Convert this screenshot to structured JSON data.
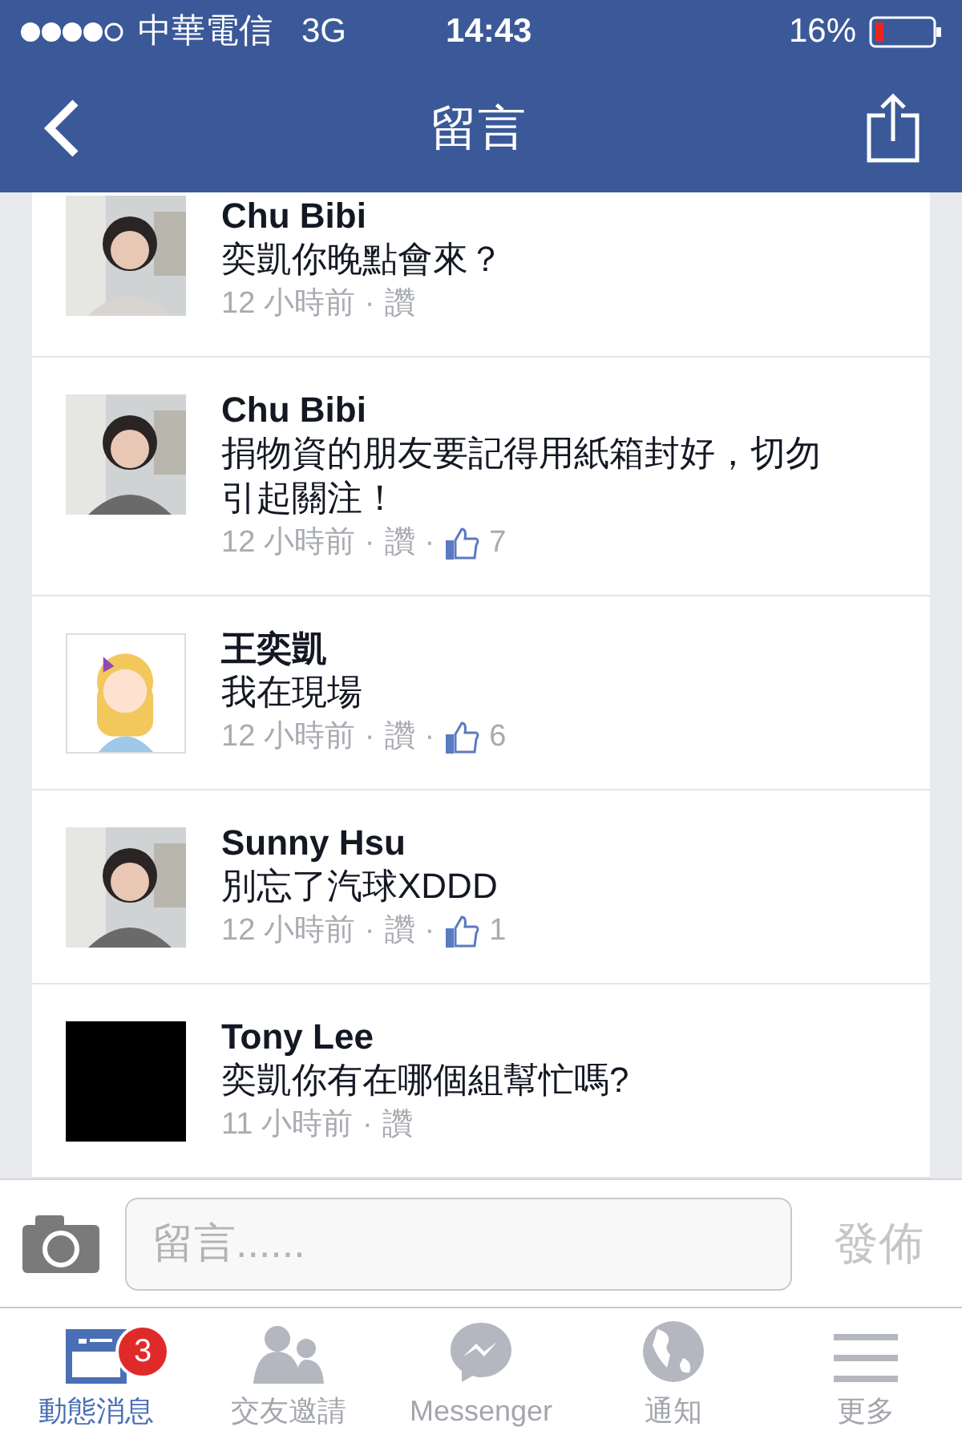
{
  "status_bar": {
    "carrier": "中華電信",
    "network": "3G",
    "time": "14:43",
    "battery": "16%"
  },
  "nav": {
    "title": "留言"
  },
  "comments": [
    {
      "name": "Chu Bibi",
      "message": "奕凱你晚點會來？",
      "time": "12 小時前",
      "dots": [
        "·"
      ],
      "like": "讚",
      "avatar": {
        "kind": "picture"
      }
    },
    {
      "name": "Chu Bibi",
      "message": "捐物資的朋友要記得用紙箱封好，切勿引起關注！",
      "time": "12 小時前",
      "dots": [
        "·",
        "·"
      ],
      "like": "讚",
      "likes": "7",
      "avatar": {
        "kind": "picture"
      }
    },
    {
      "name": "王奕凱",
      "message": "我在現場",
      "time": "12 小時前",
      "dots": [
        "·",
        "·"
      ],
      "like": "讚",
      "likes": "6",
      "avatar": {
        "kind": "cartoon"
      }
    },
    {
      "name": "Sunny Hsu",
      "message": "別忘了汽球XDDD",
      "time": "12 小時前",
      "dots": [
        "·",
        "·"
      ],
      "like": "讚",
      "likes": "1",
      "avatar": {
        "kind": "picture"
      }
    },
    {
      "name": "Tony Lee",
      "message": "奕凱你有在哪個組幫忙嗎?",
      "time": "11 小時前",
      "dots": [
        "·"
      ],
      "like": "讚",
      "avatar": {
        "kind": "dark"
      }
    }
  ],
  "composer": {
    "placeholder": "留言......",
    "submit": "發佈"
  },
  "tab_bar": [
    {
      "label": "動態消息",
      "kind": "feed",
      "selected": true,
      "badge": "3"
    },
    {
      "label": "交友邀請",
      "kind": "friends",
      "selected": false
    },
    {
      "label": "Messenger",
      "kind": "messenger",
      "selected": false
    },
    {
      "label": "通知",
      "kind": "globe",
      "selected": false
    },
    {
      "label": "更多",
      "kind": "menu",
      "selected": false
    }
  ]
}
